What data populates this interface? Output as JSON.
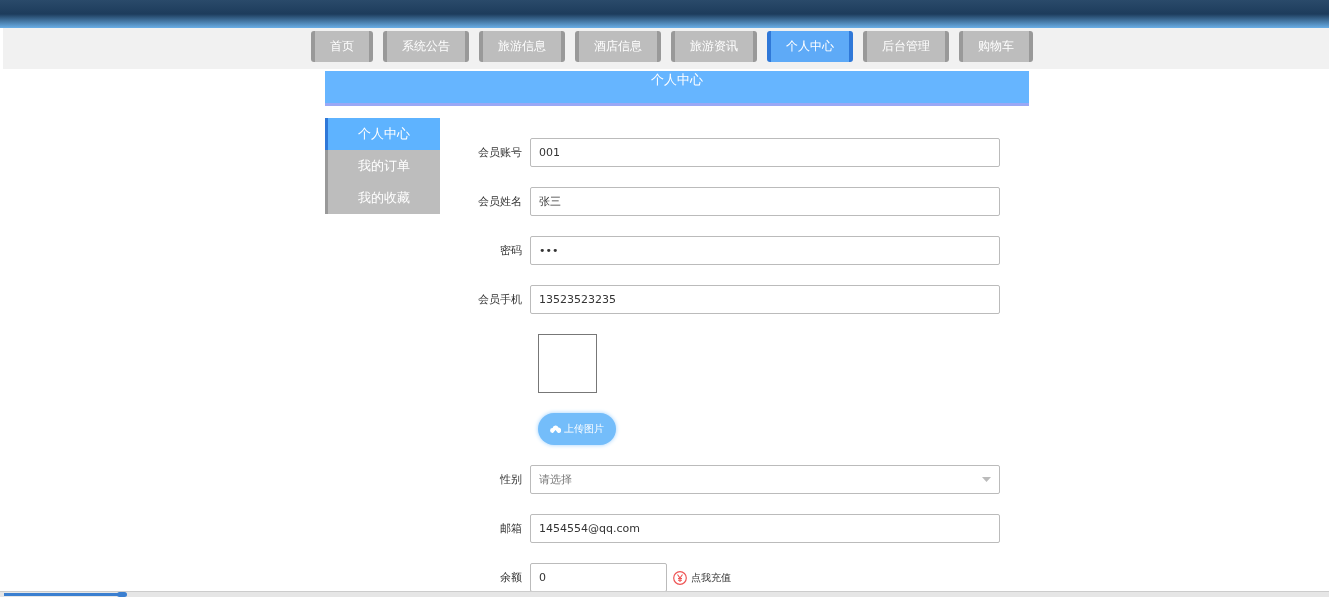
{
  "nav": {
    "tabs": [
      {
        "label": "首页",
        "selected": false
      },
      {
        "label": "系统公告",
        "selected": false
      },
      {
        "label": "旅游信息",
        "selected": false
      },
      {
        "label": "酒店信息",
        "selected": false
      },
      {
        "label": "旅游资讯",
        "selected": false
      },
      {
        "label": "个人中心",
        "selected": true
      },
      {
        "label": "后台管理",
        "selected": false
      },
      {
        "label": "购物车",
        "selected": false
      }
    ]
  },
  "banner": {
    "title": "个人中心"
  },
  "sidebar": {
    "items": [
      {
        "label": "个人中心",
        "selected": true
      },
      {
        "label": "我的订单",
        "selected": false
      },
      {
        "label": "我的收藏",
        "selected": false
      }
    ]
  },
  "form": {
    "fields": [
      {
        "kind": "text",
        "label": "会员账号",
        "value": "001"
      },
      {
        "kind": "text",
        "label": "会员姓名",
        "value": "张三"
      },
      {
        "kind": "text",
        "label": "密码",
        "value": "•••"
      },
      {
        "kind": "text",
        "label": "会员手机",
        "value": "13523523235"
      },
      {
        "kind": "image"
      },
      {
        "kind": "upload",
        "button": "上传图片"
      },
      {
        "kind": "select",
        "label": "性别",
        "placeholder": "请选择"
      },
      {
        "kind": "text",
        "label": "邮箱",
        "value": "1454554@qq.com"
      },
      {
        "kind": "balance",
        "label": "余额",
        "value": "0",
        "link": "点我充值"
      }
    ]
  },
  "player": {
    "level": 0.09
  }
}
